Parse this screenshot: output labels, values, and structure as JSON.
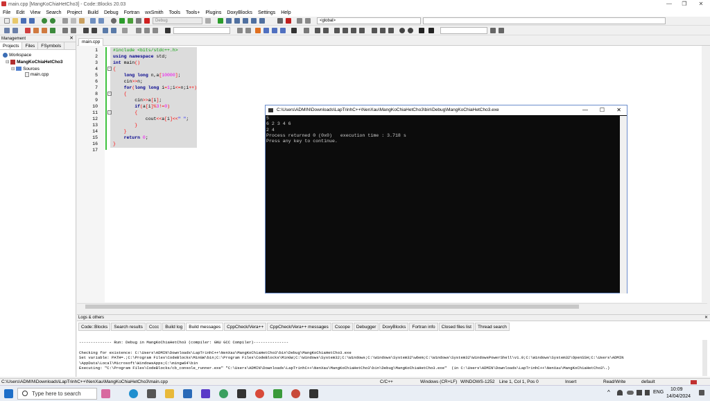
{
  "window": {
    "title": "main.cpp [MangKoChiaHetCho3] - Code::Blocks 20.03",
    "min": "—",
    "max": "❐",
    "close": "✕"
  },
  "menu": [
    "File",
    "Edit",
    "View",
    "Search",
    "Project",
    "Build",
    "Debug",
    "Fortran",
    "wxSmith",
    "Tools",
    "Tools+",
    "Plugins",
    "DoxyBlocks",
    "Settings",
    "Help"
  ],
  "toolbar": {
    "build_target": "Debug",
    "scope": "<global>",
    "symbol": ""
  },
  "management": {
    "title": "Management",
    "tabs": [
      "Projects",
      "Files",
      "FSymbols"
    ],
    "workspace": "Workspace",
    "project": "MangKoChiaHetCho3",
    "sources": "Sources",
    "file": "main.cpp"
  },
  "editor": {
    "tab": "main.cpp",
    "line_numbers": [
      "1",
      "2",
      "3",
      "4",
      "5",
      "6",
      "7",
      "8",
      "9",
      "10",
      "11",
      "12",
      "13",
      "14",
      "15",
      "16",
      "17"
    ]
  },
  "console": {
    "title": "C:\\Users\\ADMIN\\Downloads\\LapTrinhC++\\NenXau\\MangKoChiaHetCho3\\bin\\Debug\\MangKoChiaHetCho3.exe",
    "output": "5\n6 2 3 4 6\n2 4\nProcess returned 0 (0x0)   execution time : 3.718 s\nPress any key to continue."
  },
  "logs": {
    "title": "Logs & others",
    "tabs": [
      "Code::Blocks",
      "Search results",
      "Cccc",
      "Build log",
      "Build messages",
      "CppCheck/Vera++",
      "CppCheck/Vera++ messages",
      "Cscope",
      "Debugger",
      "DoxyBlocks",
      "Fortran info",
      "Closed files list",
      "Thread search"
    ],
    "text": "-------------- Run: Debug in MangKoChiaHetCho3 (compiler: GNU GCC Compiler)---------------\n\nChecking for existence: C:\\Users\\ADMIN\\Downloads\\LapTrinhC++\\NenXau\\MangKoChiaHetCho3\\bin\\Debug\\MangKoChiaHetCho3.exe\nSet variable: PATH=.;C:\\Program Files\\CodeBlocks\\MinGW\\bin;C:\\Program Files\\CodeBlocks\\MinGW;C:\\Windows\\System32;C:\\Windows;C:\\Windows\\System32\\wbem;C:\\Windows\\System32\\WindowsPowerShell\\v1.0;C:\\Windows\\System32\\OpenSSH;C:\\Users\\ADMIN\n\\AppData\\Local\\Microsoft\\WindowsApps;C:\\mingw64\\bin\nExecuting: \"C:\\Program Files\\CodeBlocks/cb_console_runner.exe\" \"C:\\Users\\ADMIN\\Downloads\\LapTrinhC++\\NenXau\\MangKoChiaHetCho3\\bin\\Debug\\MangKoChiaHetCho3.exe\"  (in C:\\Users\\ADMIN\\Downloads\\LapTrinhC++\\NenXau\\MangKoChiaHetCho3\\.)"
  },
  "status": {
    "path": "C:\\Users\\ADMIN\\Downloads\\LapTrinhC++\\NenXau\\MangKoChiaHetCho3\\main.cpp",
    "lang": "C/C++",
    "eol": "Windows (CR+LF)",
    "enc": "WINDOWS-1252",
    "pos": "Line 1, Col 1, Pos 0",
    "mode": "Insert",
    "rw": "Read/Write",
    "profile": "default"
  },
  "taskbar": {
    "search": "Type here to search",
    "lang": "ENG",
    "time": "10:09",
    "date": "14/04/2024"
  }
}
